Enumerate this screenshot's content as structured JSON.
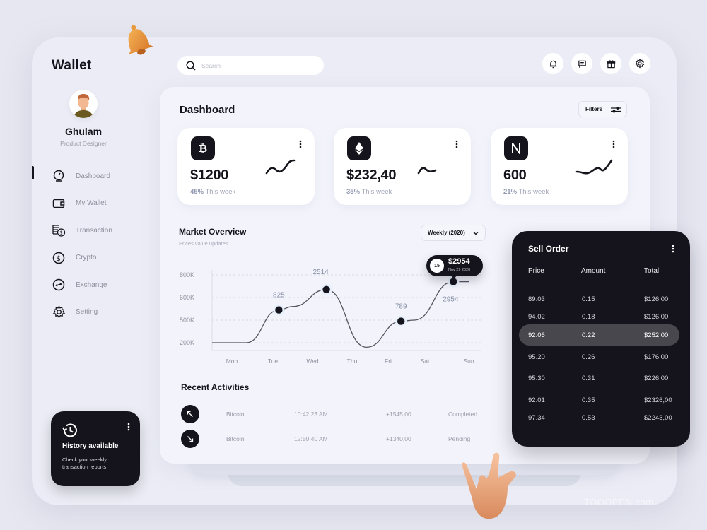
{
  "app": {
    "title": "Wallet"
  },
  "user": {
    "name": "Ghulam",
    "role": "Product Designer"
  },
  "sidebar": {
    "items": [
      {
        "label": "Dashboard",
        "icon": "speedometer-icon",
        "active": true
      },
      {
        "label": "My Wallet",
        "icon": "wallet-icon",
        "active": false
      },
      {
        "label": "Transaction",
        "icon": "coins-stack-icon",
        "active": false
      },
      {
        "label": "Crypto",
        "icon": "dollar-circle-icon",
        "active": false
      },
      {
        "label": "Exchange",
        "icon": "exchange-icon",
        "active": false
      },
      {
        "label": "Setting",
        "icon": "gear-icon",
        "active": false
      }
    ],
    "history_card": {
      "title": "History available",
      "description": "Check your weekly transaction reports",
      "icon": "history-icon"
    }
  },
  "topbar": {
    "search": {
      "placeholder": "Search",
      "value": ""
    },
    "icons": [
      "bell-icon",
      "chat-icon",
      "gift-icon",
      "gear-icon"
    ]
  },
  "dashboard": {
    "title": "Dashboard",
    "filters_label": "Filters",
    "cards": [
      {
        "coin": "Bitcoin",
        "symbol": "₿",
        "icon": "bitcoin-icon",
        "value": "$1200",
        "change": "45%",
        "change_label": "This week"
      },
      {
        "coin": "Ethereum",
        "symbol": "◆",
        "icon": "ethereum-icon",
        "value": "$232,40",
        "change": "35%",
        "change_label": "This week"
      },
      {
        "coin": "NEAR",
        "symbol": "N",
        "icon": "near-icon",
        "value": "600",
        "change": "21%",
        "change_label": "This week"
      }
    ]
  },
  "market_overview": {
    "title": "Market Overview",
    "subtitle": "Prices value updates",
    "period_select": "Weekly (2020)",
    "tooltip": {
      "badge": "15",
      "value": "$2954",
      "date": "Nov 29 2020"
    }
  },
  "chart_data": {
    "type": "line",
    "title": "Market Overview",
    "subtitle": "Prices value updates",
    "xlabel": "",
    "ylabel": "",
    "categories": [
      "Mon",
      "Tue",
      "Wed",
      "Thu",
      "Fri",
      "Sat",
      "Sun"
    ],
    "y_ticks": [
      "200K",
      "500K",
      "600K",
      "800K"
    ],
    "grid": true,
    "series": [
      {
        "name": "Price",
        "points": [
          {
            "x": 0.0,
            "level": 0.0
          },
          {
            "x": 0.35,
            "level": 0.0
          },
          {
            "x": 1.15,
            "level": 1.45,
            "marker": true,
            "label": "825"
          },
          {
            "x": 1.5,
            "level": 1.6
          },
          {
            "x": 2.35,
            "level": 2.35,
            "marker": true,
            "label": "2514"
          },
          {
            "x": 3.4,
            "level": -0.2
          },
          {
            "x": 4.35,
            "level": 0.95,
            "marker": true,
            "label": "789"
          },
          {
            "x": 4.7,
            "level": 1.0
          },
          {
            "x": 5.65,
            "level": 2.7,
            "marker": true,
            "label": "2954",
            "tooltip": true
          },
          {
            "x": 6.0,
            "level": 2.7
          }
        ]
      }
    ],
    "level_scale_note": "level 0=200K, 1=500K, 2=600K, 3=800K gridline index"
  },
  "recent_activities": {
    "title": "Recent Activities",
    "rows": [
      {
        "direction": "up",
        "icon": "arrow-up-left-icon",
        "coin": "Bitcoin",
        "time": "10:42:23 AM",
        "amount": "+1545,00",
        "status": "Completed"
      },
      {
        "direction": "down",
        "icon": "arrow-down-right-icon",
        "coin": "Bitcoin",
        "time": "12:50:40 AM",
        "amount": "+1340,00",
        "status": "Pending"
      }
    ]
  },
  "sell_order": {
    "title": "Sell Order",
    "columns": [
      "Price",
      "Amount",
      "Total"
    ],
    "rows": [
      {
        "price": "89.03",
        "amount": "0.15",
        "total": "$126,00",
        "highlighted": false
      },
      {
        "price": "94.02",
        "amount": "0.18",
        "total": "$126,00",
        "highlighted": false
      },
      {
        "price": "92.06",
        "amount": "0.22",
        "total": "$252,00",
        "highlighted": true
      },
      {
        "price": "95.20",
        "amount": "0.26",
        "total": "$176,00",
        "highlighted": false
      },
      {
        "price": "95.30",
        "amount": "0.31",
        "total": "$226,00",
        "highlighted": false
      },
      {
        "price": "92.01",
        "amount": "0.35",
        "total": "$2326,00",
        "highlighted": false
      },
      {
        "price": "97.34",
        "amount": "0.53",
        "total": "$2243,00",
        "highlighted": false
      }
    ]
  },
  "watermark": "TOOOPEN.com",
  "colors": {
    "dark": "#15141c",
    "background": "#ebecf5",
    "panel": "#f3f4fb",
    "muted": "#9a9cab",
    "highlight_row": "#48474d",
    "accent_bell": "#f0a040"
  }
}
